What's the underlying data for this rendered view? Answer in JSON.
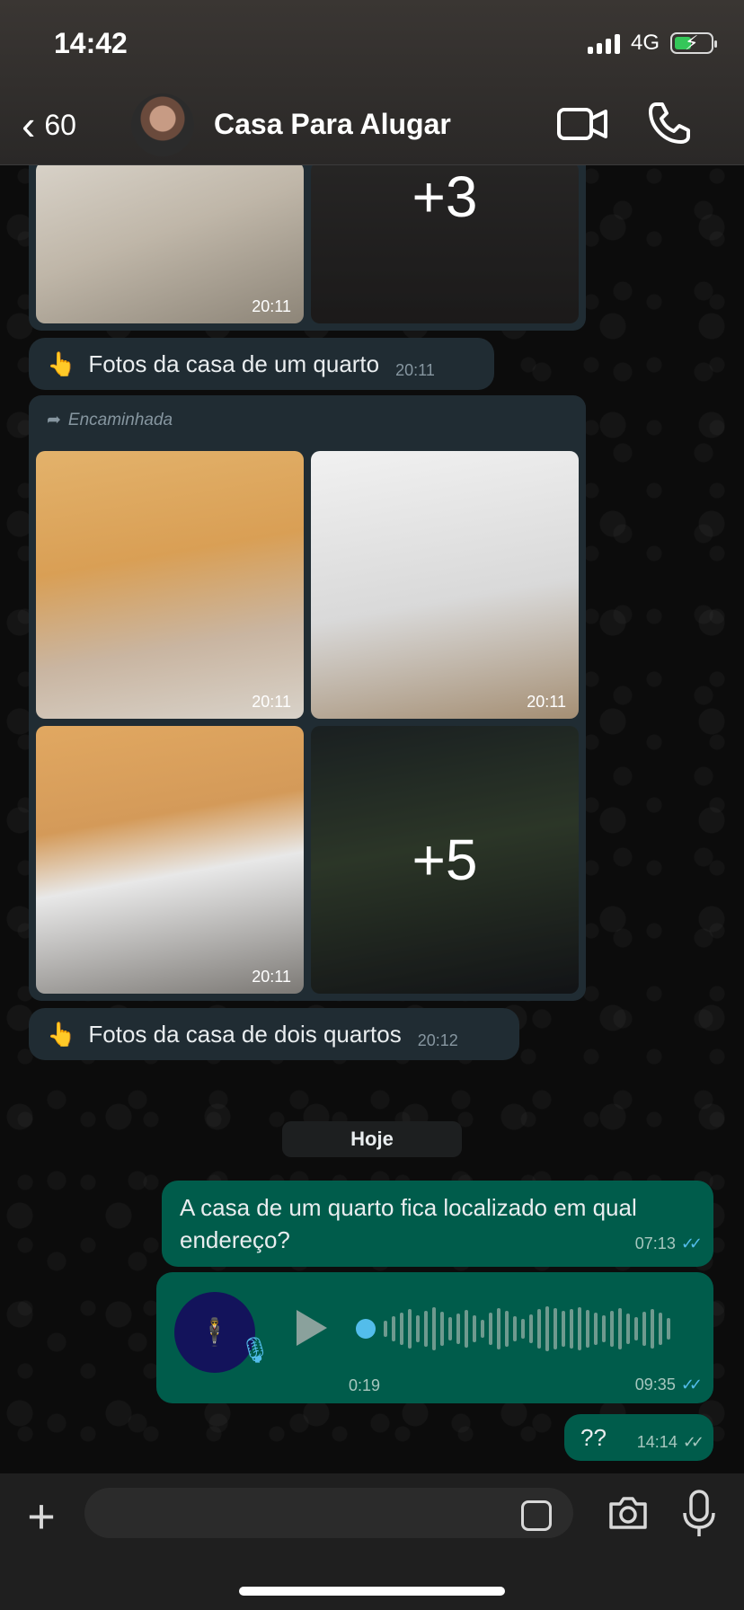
{
  "status_bar": {
    "time": "14:42",
    "network": "4G"
  },
  "header": {
    "back_count": "60",
    "contact_name": "Casa Para Alugar"
  },
  "album_top": {
    "time": "20:11",
    "more": "+3"
  },
  "caption1": {
    "emoji": "👆",
    "text": "Fotos da casa de um quarto",
    "time": "20:11"
  },
  "album_forwarded": {
    "forwarded_label": "Encaminhada",
    "times": [
      "20:11",
      "20:11",
      "20:11"
    ],
    "more": "+5"
  },
  "caption2": {
    "emoji": "👆",
    "text": "Fotos da casa de dois quartos",
    "time": "20:12"
  },
  "date_chip": "Hoje",
  "messages": [
    {
      "text": "A casa de um quarto fica localizado em qual endereço?",
      "time": "07:13"
    },
    {
      "voice_duration": "0:19",
      "time": "09:35"
    },
    {
      "text": "??",
      "time": "14:14"
    }
  ],
  "icons": {
    "video": "video-call-icon",
    "call": "phone-icon",
    "add": "plus-icon",
    "sticker": "sticker-icon",
    "camera": "camera-icon",
    "mic": "microphone-icon"
  },
  "colors": {
    "incoming_bubble": "#202c33",
    "outgoing_bubble": "#005c4b",
    "read_ticks": "#53bdeb"
  }
}
